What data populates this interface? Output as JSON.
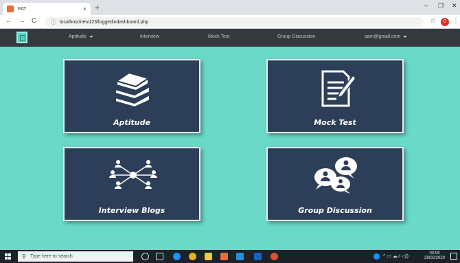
{
  "browser": {
    "tab_title": "FAT",
    "tab_close": "×",
    "new_tab": "+",
    "url": "localhost/new123/loggedindashboard.php",
    "info_glyph": "ⓘ",
    "star_glyph": "☆",
    "profile_initial": "0",
    "menu_glyph": "⋮",
    "back_glyph": "←",
    "forward_glyph": "→",
    "reload_glyph": "C",
    "min_glyph": "–",
    "max_glyph": "❐",
    "close_glyph": "✕"
  },
  "navbar": {
    "items": [
      "Aptitude",
      "Interview",
      "Mock Test",
      "Group Discussion"
    ],
    "user": "sam@gmail.com"
  },
  "cards": {
    "aptitude": "Aptitude",
    "mock_test": "Mock Test",
    "interview": "Interview Blogs",
    "group": "Group Discussion"
  },
  "taskbar": {
    "search_placeholder": "Type here to search",
    "search_glyph": "⚲",
    "time": "00:08",
    "date": "29/02/2020",
    "tray_glyphs": "^ ▭ ☁ ⁄ᵢ ◁))"
  },
  "colors": {
    "page_bg": "#6bd9c7",
    "navbar_bg": "#343a40",
    "card_bg": "#2d3e58",
    "card_border": "#e9eef3"
  }
}
